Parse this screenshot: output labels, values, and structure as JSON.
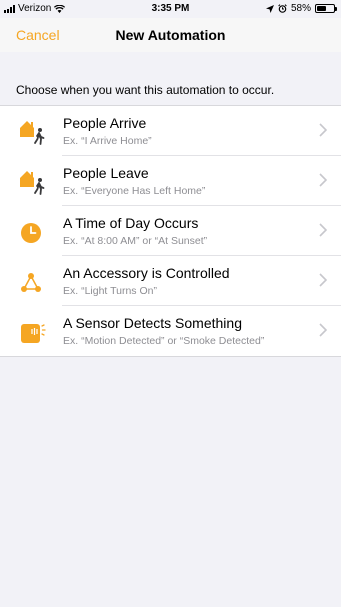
{
  "status_bar": {
    "carrier": "Verizon",
    "time": "3:35 PM",
    "battery": "58%",
    "battery_level": 0.58
  },
  "nav": {
    "cancel_label": "Cancel",
    "title": "New Automation"
  },
  "section": {
    "header": "Choose when you want this automation to occur."
  },
  "colors": {
    "accent": "#f5a623",
    "chevron": "#c7c7cc"
  },
  "triggers": [
    {
      "title": "People Arrive",
      "subtitle": "Ex. “I Arrive Home”",
      "icon": "person-arrive-home-icon"
    },
    {
      "title": "People Leave",
      "subtitle": "Ex. “Everyone Has Left Home”",
      "icon": "person-leave-home-icon"
    },
    {
      "title": "A Time of Day Occurs",
      "subtitle": "Ex. “At 8:00 AM” or “At Sunset”",
      "icon": "clock-icon"
    },
    {
      "title": "An Accessory is Controlled",
      "subtitle": "Ex. “Light Turns On”",
      "icon": "accessory-network-icon"
    },
    {
      "title": "A Sensor Detects Something",
      "subtitle": "Ex. “Motion Detected” or “Smoke Detected”",
      "icon": "sensor-icon"
    }
  ]
}
